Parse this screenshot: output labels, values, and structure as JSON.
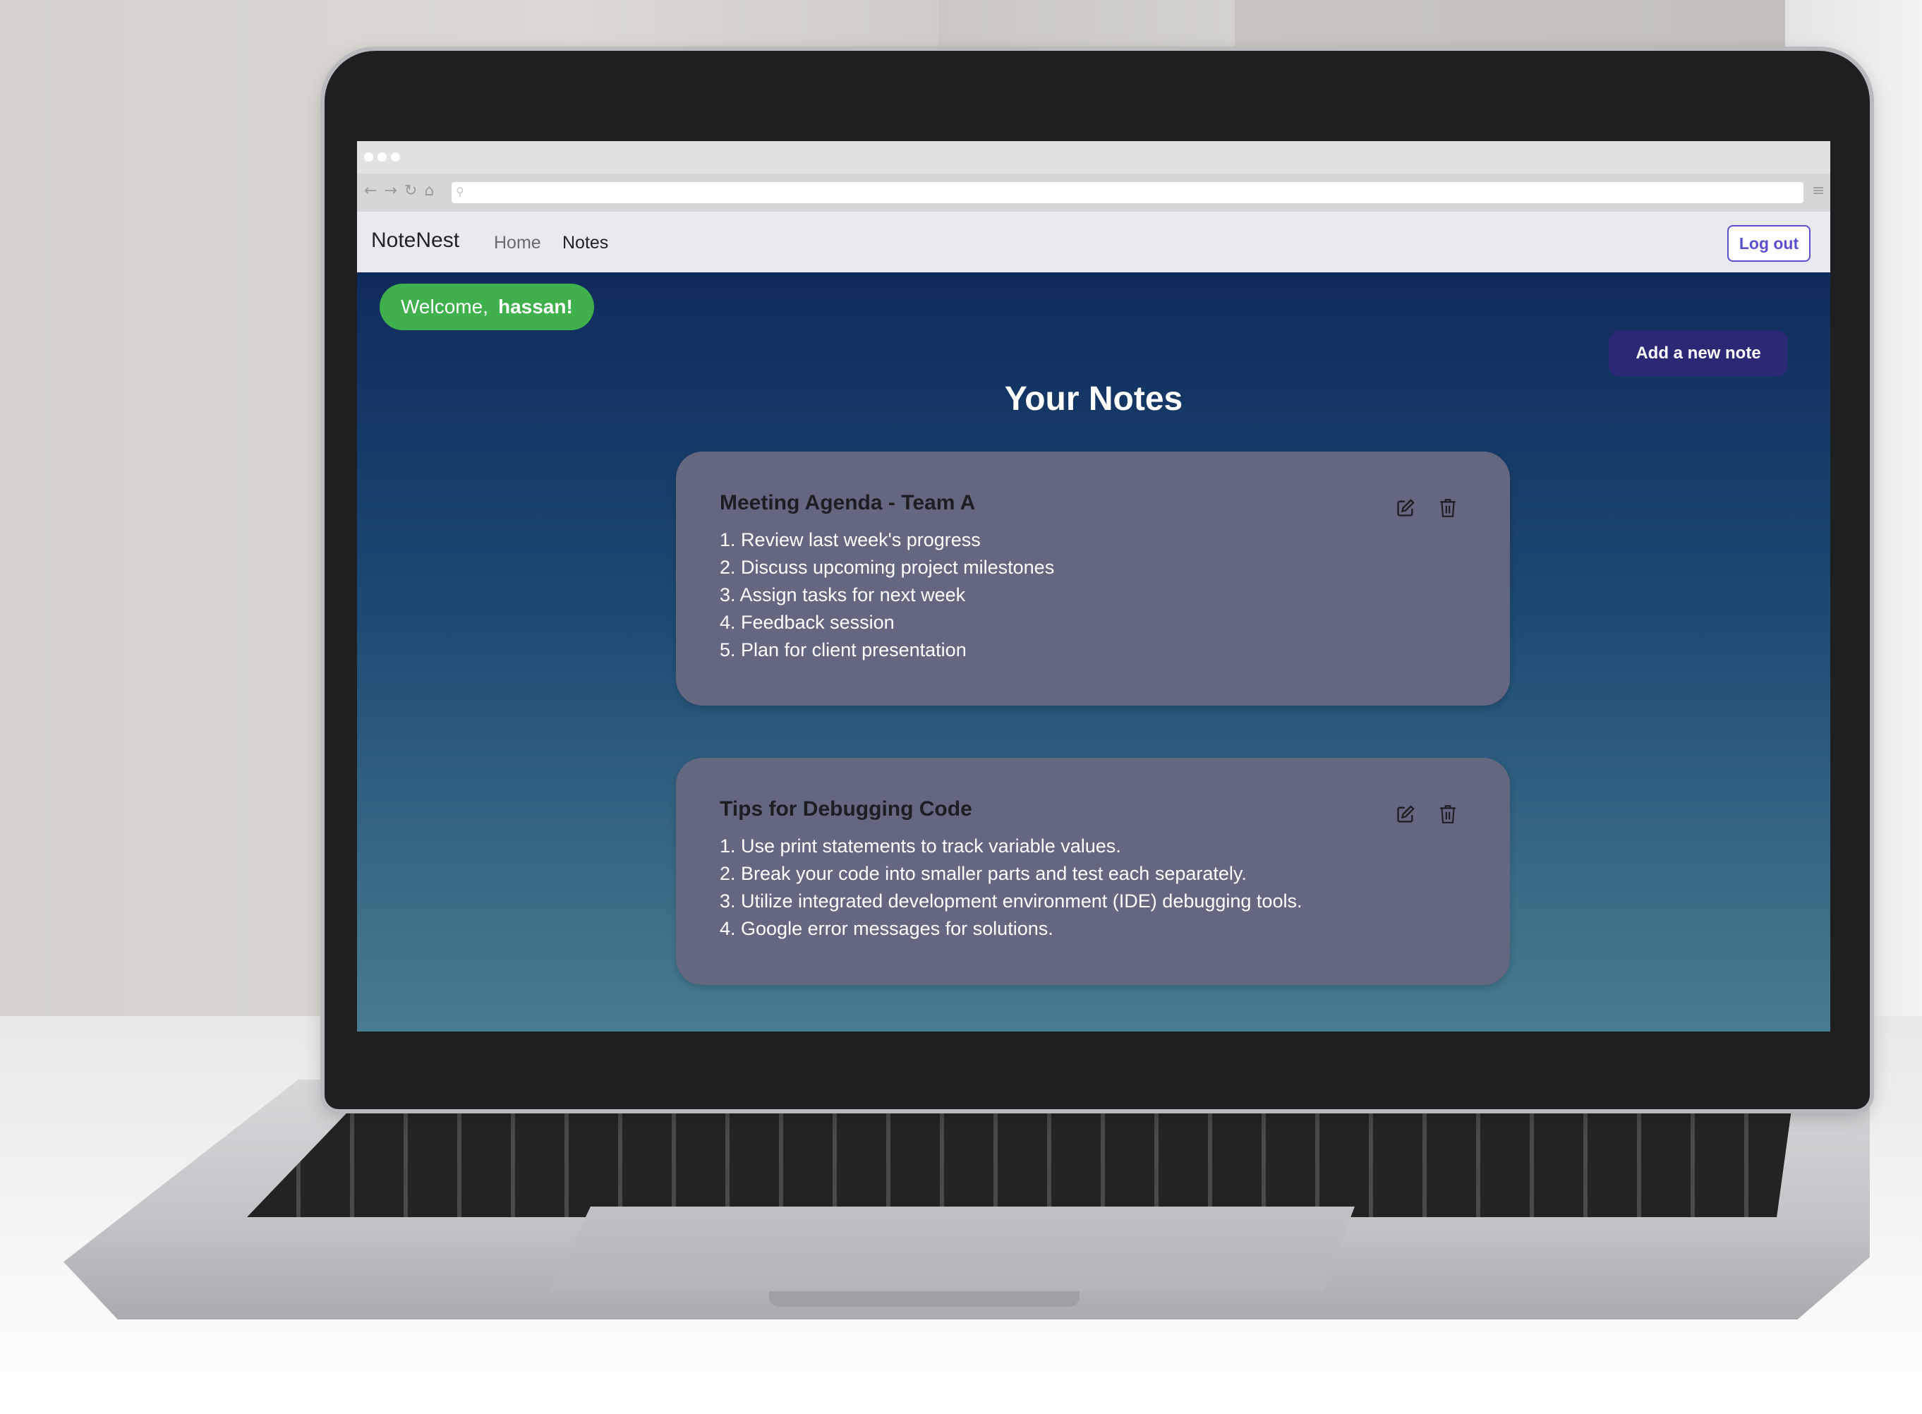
{
  "browser": {
    "nav_icons": [
      "back-arrow-icon",
      "forward-arrow-icon",
      "reload-icon",
      "home-icon"
    ],
    "address_text": ""
  },
  "navbar": {
    "brand": "NoteNest",
    "links": [
      {
        "label": "Home",
        "active": false
      },
      {
        "label": "Notes",
        "active": true
      }
    ],
    "logout_label": "Log out"
  },
  "welcome": {
    "prefix": "Welcome,",
    "username": "hassan!"
  },
  "actions": {
    "add_note_label": "Add a new note"
  },
  "page": {
    "title": "Your Notes"
  },
  "notes": [
    {
      "title": "Meeting Agenda - Team A",
      "lines": [
        "1. Review last week's progress",
        "2. Discuss upcoming project milestones",
        "3. Assign tasks for next week",
        "4. Feedback session",
        "5. Plan for client presentation"
      ]
    },
    {
      "title": "Tips for Debugging Code",
      "lines": [
        "1. Use print statements to track variable values.",
        "2. Break your code into smaller parts and test each separately.",
        "3. Utilize integrated development environment (IDE) debugging tools.",
        "4. Google error messages for solutions."
      ]
    }
  ],
  "colors": {
    "welcome_bg": "#3fb04c",
    "accent": "#5a4fcf",
    "add_button_bg": "#2b2875",
    "card_bg": "#646780",
    "gradient_top": "#0f2b5c",
    "gradient_bottom": "#487c91"
  }
}
